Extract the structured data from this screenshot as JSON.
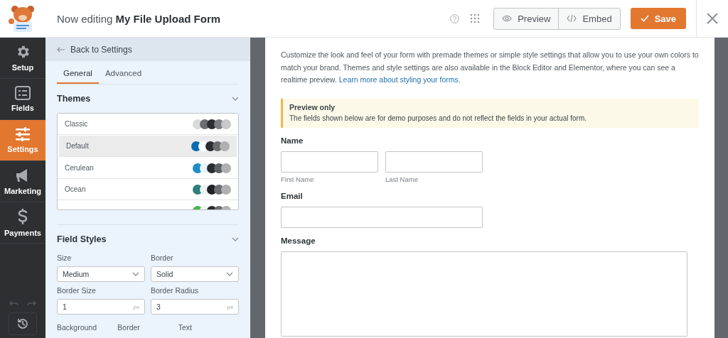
{
  "header": {
    "prefix": "Now editing",
    "form_name": "My File Upload Form",
    "buttons": [
      {
        "label": "Preview",
        "kind": "preview"
      },
      {
        "label": "Embed",
        "kind": "embed"
      }
    ],
    "save": "Save"
  },
  "nav": [
    {
      "label": "Setup",
      "kind": "setup",
      "selected": false
    },
    {
      "label": "Fields",
      "kind": "fields",
      "selected": false
    },
    {
      "label": "Settings",
      "kind": "settings",
      "selected": true
    },
    {
      "label": "Marketing",
      "kind": "marketing",
      "selected": false
    },
    {
      "label": "Payments",
      "kind": "payments",
      "selected": false
    }
  ],
  "panel": {
    "back": "Back to Settings",
    "tabs": [
      {
        "label": "General",
        "selected": true
      },
      {
        "label": "Advanced",
        "selected": false
      }
    ],
    "themes": {
      "title": "Themes",
      "items": [
        {
          "name": "Classic",
          "selected": false,
          "swatches": [
            {
              "color": "#d9d9d9"
            },
            {
              "color": "#6b6d70"
            },
            {
              "color": "#2b2d30"
            },
            {
              "color": "#7c7e82"
            },
            {
              "color": "#c8c8c8"
            }
          ]
        },
        {
          "name": "Default",
          "selected": true,
          "swatches": [
            {
              "color": "#0b6bb0"
            },
            {
              "color": "#ffffff"
            },
            {
              "color": "#2a2c2f"
            },
            {
              "color": "#6b6d70"
            },
            {
              "color": "#b0b0b0"
            }
          ]
        },
        {
          "name": "Cerulean",
          "selected": false,
          "swatches": [
            {
              "color": "#1d8dc9"
            },
            {
              "color": "#e8f4fb"
            },
            {
              "color": "#2a2c2f"
            },
            {
              "color": "#5c5f63"
            },
            {
              "color": "#b0b0b0"
            }
          ]
        },
        {
          "name": "Ocean",
          "selected": false,
          "swatches": [
            {
              "color": "#2e7f7b"
            },
            {
              "color": "#eef2f2"
            },
            {
              "color": "#1f2124"
            },
            {
              "color": "#6b6d70"
            },
            {
              "color": "#b0b0b0"
            }
          ]
        },
        {
          "selected": false,
          "swatches": [
            {
              "color": "#4cb555"
            },
            {
              "color": "#eef6ee"
            },
            {
              "color": "#2a2c2f"
            },
            {
              "color": "#6b6d70"
            },
            {
              "color": "#b0b0b0"
            }
          ]
        }
      ]
    },
    "field_styles": {
      "title": "Field Styles",
      "controls": [
        {
          "label": "Size",
          "kind": "select",
          "value": "Medium"
        },
        {
          "label": "Border",
          "kind": "select",
          "value": "Solid"
        },
        {
          "label": "Border Size",
          "kind": "number",
          "value": "1",
          "unit": "px"
        },
        {
          "label": "Border Radius",
          "kind": "number",
          "value": "3",
          "unit": "px"
        }
      ],
      "color_labels": [
        "Background",
        "Border",
        "Text"
      ]
    }
  },
  "form": {
    "intro": "Customize the look and feel of your form with premade themes or simple style settings that allow you to use your own colors to match your brand. Themes and style settings are also available in the Block Editor and Elementor, where you can see a realtime preview.",
    "link": "Learn more about styling your forms",
    "link_end": ".",
    "notice": {
      "title": "Preview only",
      "text": "The fields shown below are for demo purposes and do not reflect the fields in your actual form."
    },
    "fields": [
      {
        "label": "Name",
        "kind": "name",
        "sublabels": [
          "First Name",
          "Last Name"
        ]
      },
      {
        "label": "Email",
        "kind": "text"
      },
      {
        "label": "Message",
        "kind": "textarea"
      }
    ]
  }
}
